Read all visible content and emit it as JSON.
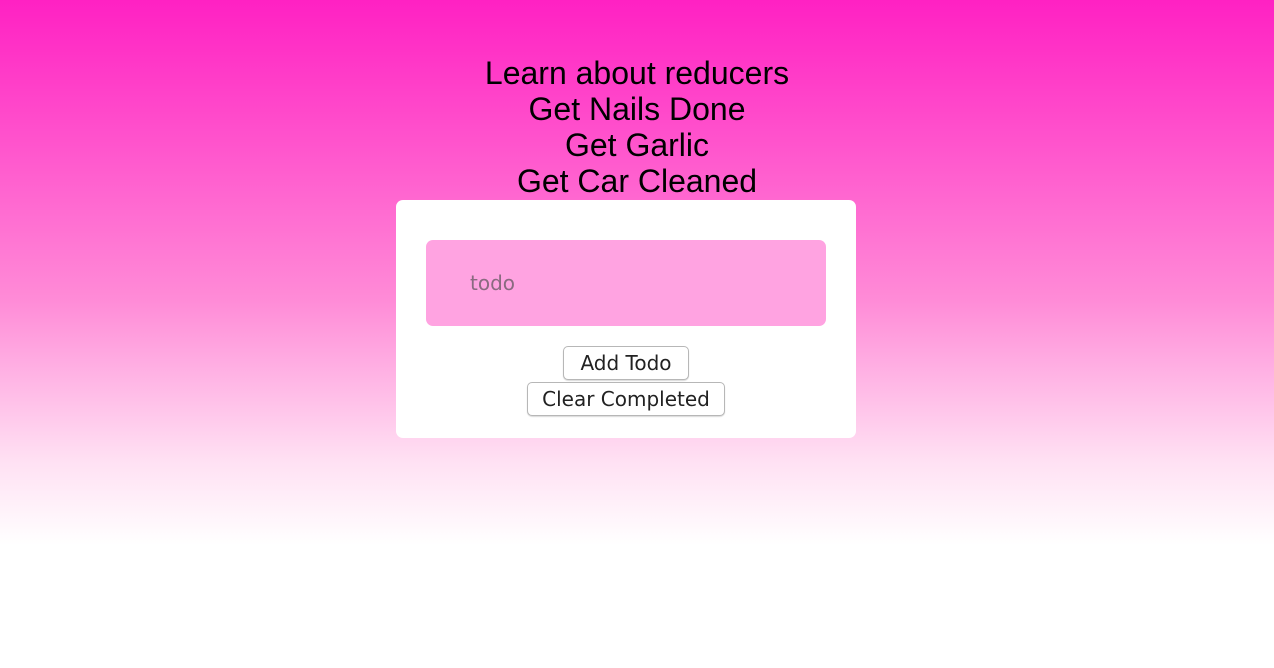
{
  "todos": [
    {
      "label": "Learn about reducers"
    },
    {
      "label": "Get Nails Done"
    },
    {
      "label": "Get Garlic"
    },
    {
      "label": "Get Car Cleaned"
    }
  ],
  "form": {
    "input_placeholder": "todo",
    "input_value": "",
    "add_label": "Add Todo",
    "clear_label": "Clear Completed"
  },
  "colors": {
    "gradient_top": "#ff21c3",
    "gradient_bottom": "#ffffff",
    "card_background": "#ffffff",
    "input_background": "#ffa3e1"
  }
}
